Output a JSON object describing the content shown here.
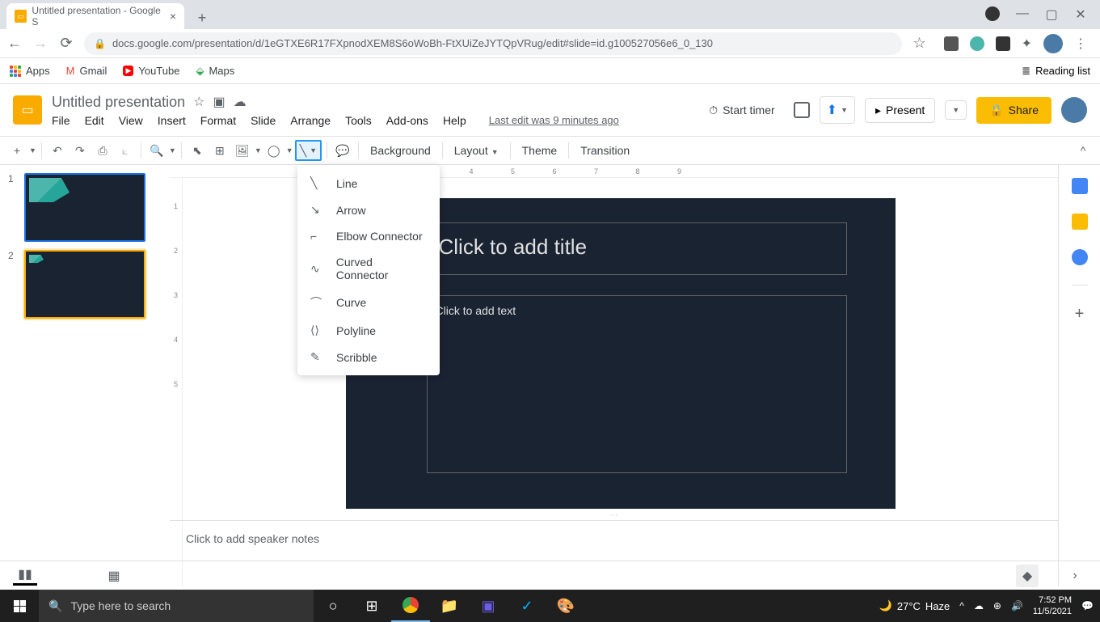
{
  "browser": {
    "tab_title": "Untitled presentation - Google S",
    "url": "docs.google.com/presentation/d/1eGTXE6R17FXpnodXEM8S6oWoBh-FtXUiZeJYTQpVRug/edit#slide=id.g100527056e6_0_130",
    "bookmarks": {
      "apps": "Apps",
      "gmail": "Gmail",
      "youtube": "YouTube",
      "maps": "Maps",
      "reading_list": "Reading list"
    }
  },
  "app": {
    "doc_title": "Untitled presentation",
    "menus": {
      "file": "File",
      "edit": "Edit",
      "view": "View",
      "insert": "Insert",
      "format": "Format",
      "slide": "Slide",
      "arrange": "Arrange",
      "tools": "Tools",
      "addons": "Add-ons",
      "help": "Help"
    },
    "last_edit": "Last edit was 9 minutes ago",
    "start_timer": "Start timer",
    "present": "Present",
    "share": "Share"
  },
  "toolbar": {
    "background": "Background",
    "layout": "Layout",
    "theme": "Theme",
    "transition": "Transition"
  },
  "line_menu": {
    "line": "Line",
    "arrow": "Arrow",
    "elbow": "Elbow Connector",
    "curved": "Curved Connector",
    "curve": "Curve",
    "polyline": "Polyline",
    "scribble": "Scribble"
  },
  "slides": {
    "s1": "1",
    "s2": "2"
  },
  "canvas": {
    "title_placeholder": "Click to add title",
    "text_placeholder": "Click to add text"
  },
  "notes": {
    "placeholder": "Click to add speaker notes"
  },
  "taskbar": {
    "search_placeholder": "Type here to search",
    "weather_temp": "27°C",
    "weather_cond": "Haze",
    "time": "7:52 PM",
    "date": "11/5/2021"
  }
}
